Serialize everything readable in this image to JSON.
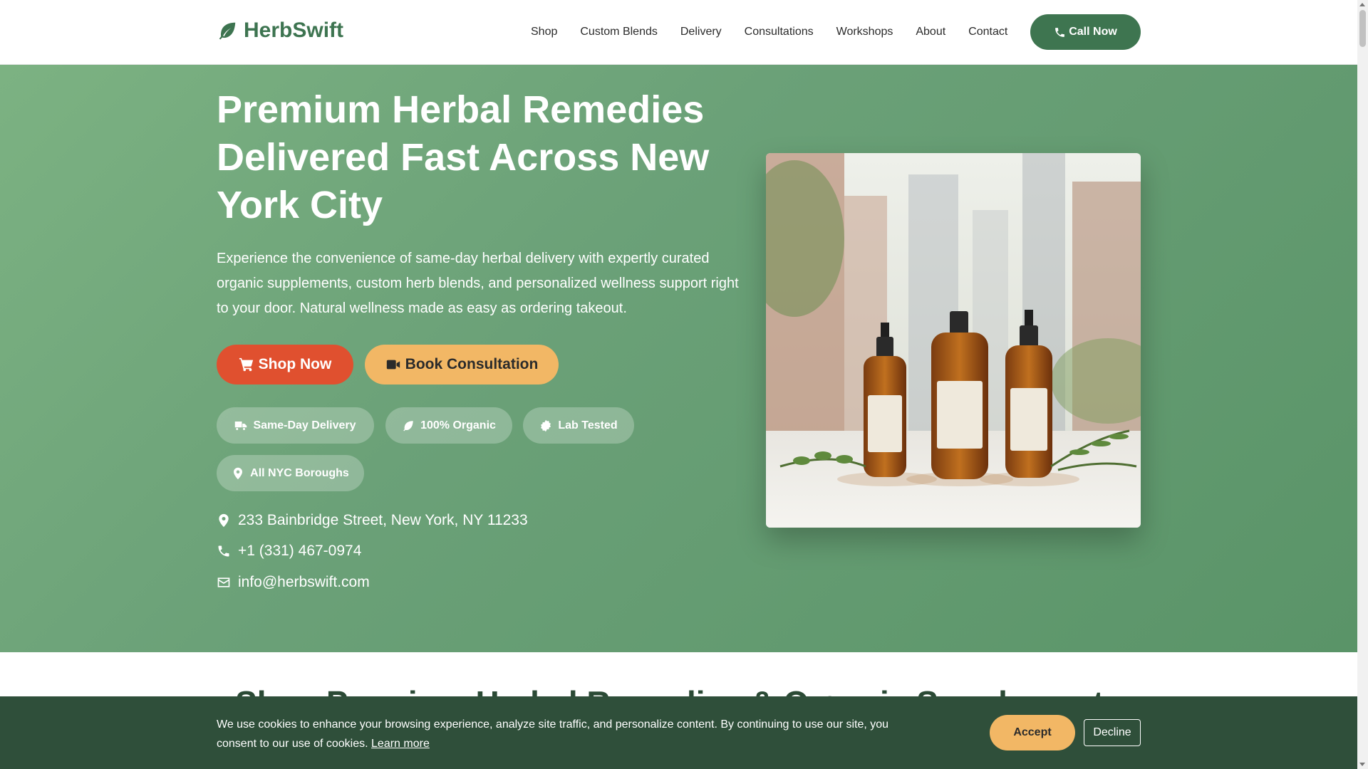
{
  "brand": {
    "name": "HerbSwift",
    "logo_icon": "leaf-icon",
    "color": "#3d7450"
  },
  "nav": {
    "items": [
      {
        "label": "Shop"
      },
      {
        "label": "Custom Blends"
      },
      {
        "label": "Delivery"
      },
      {
        "label": "Consultations"
      },
      {
        "label": "Workshops"
      },
      {
        "label": "About"
      },
      {
        "label": "Contact"
      }
    ],
    "call_button": {
      "label": "Call Now",
      "icon": "phone-icon"
    }
  },
  "hero": {
    "title": "Premium Herbal Remedies Delivered Fast Across New York City",
    "description": "Experience the convenience of same-day herbal delivery with expertly curated organic supplements, custom herb blends, and personalized wellness support right to your door. Natural wellness made as easy as ordering takeout.",
    "primary_button": {
      "label": "Shop Now",
      "icon": "cart-icon",
      "color": "#e0502f"
    },
    "secondary_button": {
      "label": "Book Consultation",
      "icon": "video-icon",
      "color": "#f2b765"
    },
    "badges": [
      {
        "label": "Same-Day Delivery",
        "icon": "truck-icon"
      },
      {
        "label": "100% Organic",
        "icon": "leaf-icon"
      },
      {
        "label": "Lab Tested",
        "icon": "certificate-icon"
      },
      {
        "label": "All NYC Boroughs",
        "icon": "map-pin-icon"
      }
    ],
    "contact": {
      "address": "233 Bainbridge Street, New York, NY 11233",
      "phone": "+1 (331) 467-0974",
      "email": "info@herbswift.com"
    }
  },
  "next_section": {
    "title": "Shop Premium Herbal Remedies & Organic Supplements"
  },
  "cookie_banner": {
    "text": "We use cookies to enhance your browsing experience, analyze site traffic, and personalize content. By continuing to use our site, you consent to our use of cookies.",
    "learn_more": "Learn more",
    "accept": "Accept",
    "decline": "Decline"
  }
}
